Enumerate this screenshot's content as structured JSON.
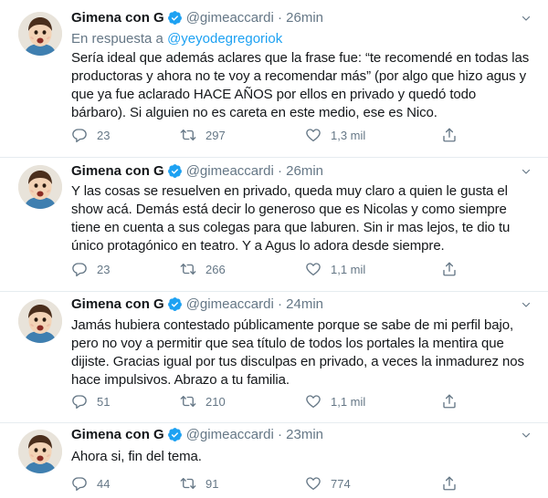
{
  "tweets": [
    {
      "name": "Gimena con G",
      "handle": "@gimeaccardi",
      "time": "26min",
      "reply_prefix": "En respuesta a",
      "reply_to": "@yeyodegregoriok",
      "text": "Sería ideal que además aclares que la frase fue: “te recomendé en todas las productoras y ahora no te voy a recomendar más” (por algo que hizo agus y que ya fue aclarado HACE AÑOS por ellos en privado y quedó todo bárbaro). Si alguien no es careta en este medio, ese es Nico.",
      "replies": "23",
      "retweets": "297",
      "likes": "1,3 mil"
    },
    {
      "name": "Gimena con G",
      "handle": "@gimeaccardi",
      "time": "26min",
      "text": "Y las cosas se resuelven en privado, queda muy claro a quien le gusta el show acá. Demás está decir lo generoso que es Nicolas y como siempre tiene en cuenta a sus colegas para que laburen. Sin ir mas lejos, te dio tu único protagónico en teatro. Y a Agus lo adora desde siempre.",
      "replies": "23",
      "retweets": "266",
      "likes": "1,1 mil"
    },
    {
      "name": "Gimena con G",
      "handle": "@gimeaccardi",
      "time": "24min",
      "text": "Jamás hubiera contestado públicamente porque se sabe de mi perfil bajo, pero no voy a permitir que sea título de todos los portales la mentira que dijiste. Gracias igual por tus disculpas en privado, a veces la inmadurez nos hace impulsivos. Abrazo a tu familia.",
      "replies": "51",
      "retweets": "210",
      "likes": "1,1 mil"
    },
    {
      "name": "Gimena con G",
      "handle": "@gimeaccardi",
      "time": "23min",
      "text": "Ahora si, fin del tema.",
      "replies": "44",
      "retweets": "91",
      "likes": "774"
    }
  ],
  "colors": {
    "accent": "#1da1f2",
    "muted": "#657786",
    "text": "#14171a",
    "border": "#e6ecf0"
  },
  "icons": [
    "verified-badge-icon",
    "chevron-down-icon",
    "reply-icon",
    "retweet-icon",
    "like-icon",
    "share-icon"
  ]
}
